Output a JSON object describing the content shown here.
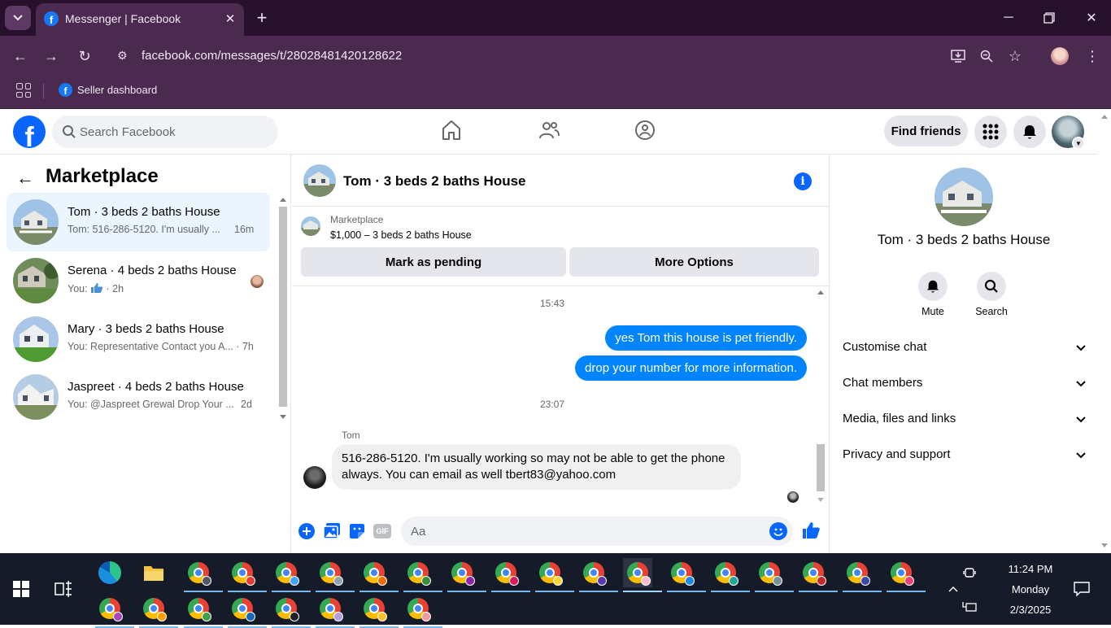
{
  "browser": {
    "tab_title": "Messenger | Facebook",
    "url": "facebook.com/messages/t/28028481420128622",
    "bookmark_label": "Seller dashboard"
  },
  "fb": {
    "logo": "f",
    "search_placeholder": "Search Facebook",
    "find_friends": "Find friends"
  },
  "left": {
    "title": "Marketplace",
    "conversations": [
      {
        "name": "Tom · 3 beds 2 baths House",
        "snippet": "Tom: 516-286-5120. I'm usually ...",
        "time": "16m"
      },
      {
        "name": "Serena · 4 beds 2 baths House",
        "snippet": "You: ",
        "time": "· 2h"
      },
      {
        "name": "Mary · 3 beds 2 baths House",
        "snippet": "You: Representative Contact you A...",
        "time": "· 7h"
      },
      {
        "name": "Jaspreet · 4 beds 2 baths House",
        "snippet": "You: @Jaspreet Grewal Drop Your ...",
        "time": "2d"
      }
    ]
  },
  "chat": {
    "title": "Tom · 3 beds 2 baths House",
    "listing_source": "Marketplace",
    "listing_price": "$1,000 – 3 beds 2 baths House",
    "mark_pending": "Mark as pending",
    "more_options": "More Options",
    "ts1": "15:43",
    "out1": "yes Tom this house is pet friendly.",
    "out2": "drop your number for more information.",
    "ts2": "23:07",
    "sender": "Tom",
    "in1": "516-286-5120. I'm usually working so may not be able to get the phone always. You can email as well tbert83@yahoo.com",
    "composer_placeholder": "Aa",
    "gif_label": "GIF"
  },
  "right": {
    "name": "Tom · 3 beds 2 baths House",
    "mute": "Mute",
    "search": "Search",
    "sections": [
      "Customise chat",
      "Chat members",
      "Media, files and links",
      "Privacy and support"
    ]
  },
  "taskbar": {
    "time": "11:24 PM",
    "day": "Monday",
    "date": "2/3/2025"
  },
  "colors": {
    "fb_blue": "#0866ff",
    "bubble_blue": "#0084ff",
    "browser_dark": "#27102b",
    "browser_mid": "#4a2a4f",
    "taskbar": "#161b29"
  }
}
